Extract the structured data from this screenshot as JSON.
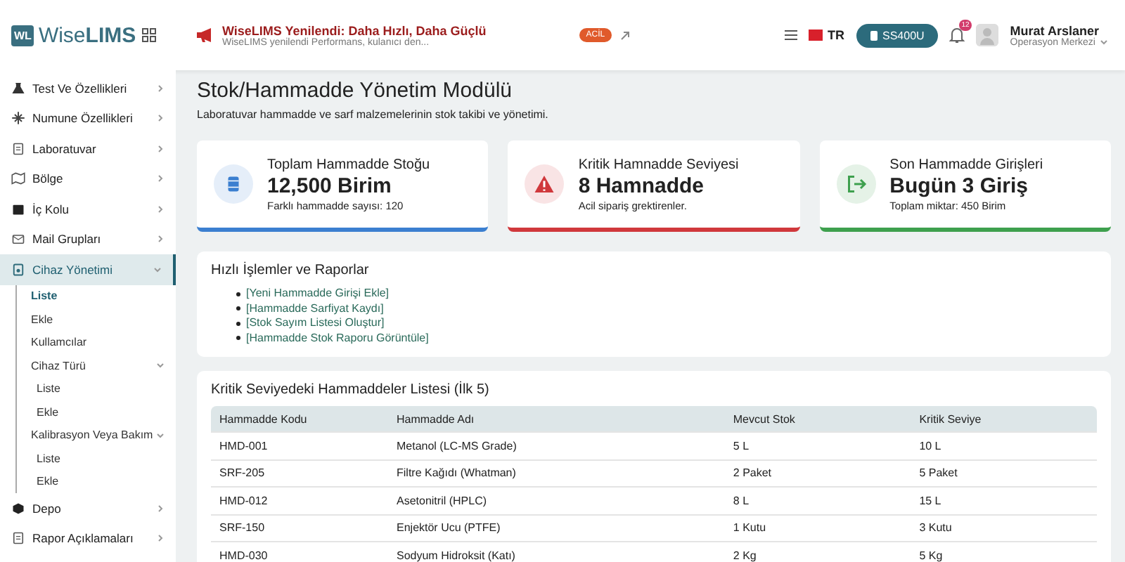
{
  "header": {
    "logo_badge": "WL",
    "logo_text": "Wise**LIMS**",
    "announcement": {
      "title": "WiseLIMS Yenilendi: Daha Hızlı, Daha Güçlü",
      "subtitle": "WiseLIMS yenilendi Performans, kulanıcı den...",
      "badge": "ACİL"
    },
    "language": "TR",
    "device_button": "SS400U",
    "notification_count": "12",
    "user": {
      "name": "Murat Arslaner",
      "role": "Operasyon Merkezi"
    }
  },
  "sidebar": {
    "items": [
      {
        "label": "Test Ve Özellikleri",
        "expanded": false,
        "selected": false
      },
      {
        "label": "Numune Özellikleri",
        "expanded": false,
        "selected": false
      },
      {
        "label": "Laboratuvar",
        "expanded": false,
        "selected": false
      },
      {
        "label": "Bölge",
        "expanded": false,
        "selected": false
      },
      {
        "label": "İç Kolu",
        "expanded": false,
        "selected": false
      },
      {
        "label": "Mail Grupları",
        "expanded": false,
        "selected": false
      },
      {
        "label": "Cihaz Yönetimi",
        "expanded": true,
        "selected": true,
        "children": [
          {
            "label": "Liste",
            "selected": true
          },
          {
            "label": "Ekle",
            "selected": false
          },
          {
            "label": "Kullamcılar",
            "selected": false
          },
          {
            "label": "Cihaz Türü",
            "selected": false,
            "expanded": true,
            "children": [
              {
                "label": "Liste",
                "selected": false
              },
              {
                "label": "Ekle",
                "selected": false
              }
            ]
          },
          {
            "label": "Kalibrasyon Veya Bakım",
            "selected": false,
            "expanded": true,
            "children": [
              {
                "label": "Liste",
                "selected": false
              },
              {
                "label": "Ekle",
                "selected": false
              }
            ]
          }
        ]
      },
      {
        "label": "Depo",
        "expanded": false,
        "selected": false
      },
      {
        "label": "Rapor Açıklamaları",
        "expanded": false,
        "selected": false
      }
    ]
  },
  "page": {
    "title": "Stok/Hammadde Yönetim Modülü",
    "subtitle": "Laboratuvar hammadde ve sarf malzemelerinin stok takibi ve yönetimi."
  },
  "cards": [
    {
      "kind": "barrel",
      "color": "#3b7fd0",
      "title": "Toplam Hammadde Stoğu",
      "value": "12,500 Birim",
      "note": "Farklı hammadde sayısı: 120"
    },
    {
      "kind": "warning",
      "color": "#d0383c",
      "title": "Kritik Hamnadde Seviyesi",
      "value": "8 Hamnadde",
      "note": "Acil sipariş grektirenler."
    },
    {
      "kind": "entry",
      "color": "#3ea04e",
      "title": "Son Hammadde Girişleri",
      "value": "Bugün 3 Giriş",
      "note": "Toplam miktar: 450 Birim"
    }
  ],
  "quick_actions": {
    "title": "Hızlı İşlemler ve Raporlar",
    "links": [
      "[Yeni Hammadde Girişi Ekle]",
      "[Hammadde Sarfiyat Kaydı]",
      "[Stok Sayım Listesi Oluştur]",
      "[Hammadde Stok Raporu Görüntüle]"
    ]
  },
  "critical_table": {
    "title": "Kritik Seviyedeki Hammaddeler Listesi (İlk 5)",
    "columns": [
      "Hammadde Kodu",
      "Hammadde Adı",
      "Mevcut Stok",
      "Kritik Seviye"
    ],
    "rows": [
      [
        "HMD-001",
        "Metanol (LC-MS Grade)",
        "5 L",
        "10 L"
      ],
      [
        "SRF-205",
        "Filtre Kağıdı (Whatman)",
        "2 Paket",
        "5 Paket"
      ],
      [
        "HMD-012",
        "Asetonitril (HPLC)",
        "8 L",
        "15 L"
      ],
      [
        "SRF-150",
        "Enjektör Ucu (PTFE)",
        "1 Kutu",
        "3 Kutu"
      ],
      [
        "HMD-030",
        "Sodyum Hidroksit (Katı)",
        "2 Kg",
        "5 Kg"
      ]
    ]
  }
}
